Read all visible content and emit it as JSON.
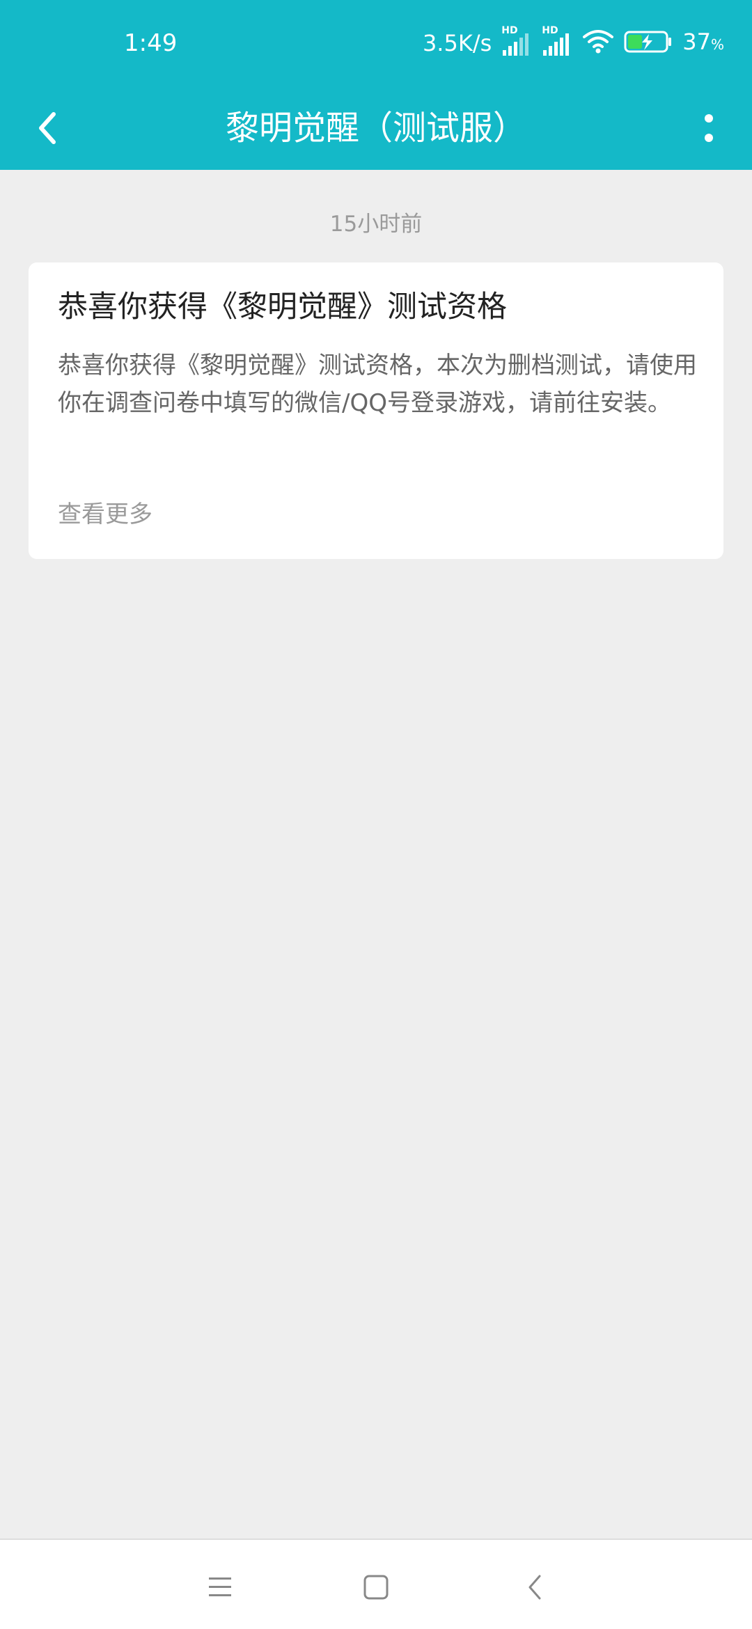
{
  "status_bar": {
    "time": "1:49",
    "net_speed": "3.5K/s",
    "signal_badge_1": "HD",
    "signal_badge_2": "HD",
    "battery_percent": "37",
    "battery_unit": "%"
  },
  "app_bar": {
    "title": "黎明觉醒（测试服）",
    "back_icon": "chevron-left-icon",
    "more_icon": "more-vertical-icon"
  },
  "message": {
    "timestamp": "15小时前",
    "title": "恭喜你获得《黎明觉醒》测试资格",
    "body": "恭喜你获得《黎明觉醒》测试资格，本次为删档测试，请使用你在调查问卷中填写的微信/QQ号登录游戏，请前往安装。",
    "more_link": "查看更多"
  },
  "nav_bar": {
    "menu_icon": "menu-icon",
    "home_icon": "home-square-icon",
    "back_icon": "back-triangle-icon"
  },
  "colors": {
    "accent": "#14b9c8",
    "background": "#eeeeee",
    "card": "#ffffff"
  }
}
